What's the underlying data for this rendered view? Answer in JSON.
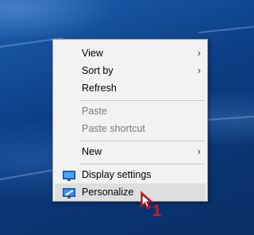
{
  "menu": {
    "items": [
      {
        "label": "View",
        "submenu": true
      },
      {
        "label": "Sort by",
        "submenu": true
      },
      {
        "label": "Refresh"
      },
      {
        "label": "Paste",
        "disabled": true
      },
      {
        "label": "Paste shortcut",
        "disabled": true
      },
      {
        "label": "New",
        "submenu": true
      },
      {
        "label": "Display settings",
        "icon": "display-settings-icon"
      },
      {
        "label": "Personalize",
        "icon": "personalize-icon",
        "highlighted": true
      }
    ],
    "arrow_glyph": "›"
  },
  "annotation": {
    "step_number": "1",
    "color": "#e0141e"
  }
}
